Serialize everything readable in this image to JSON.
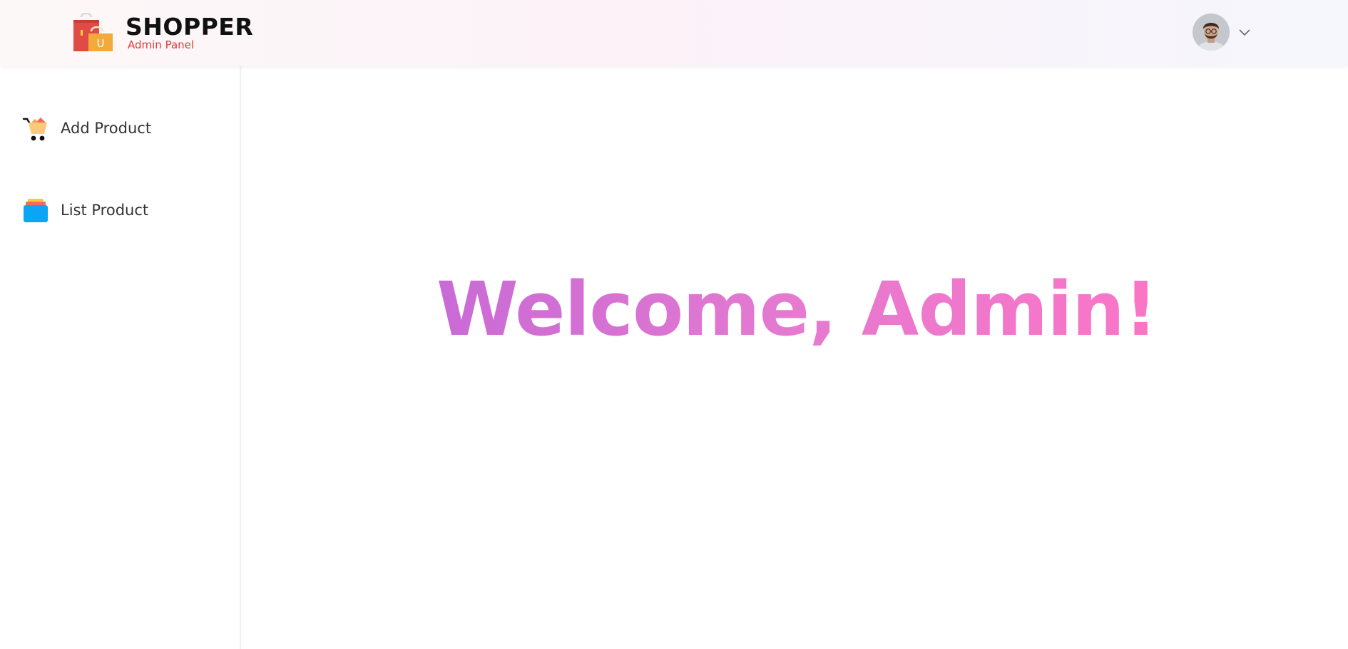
{
  "brand": {
    "name": "SHOPPER",
    "subtitle": "Admin Panel",
    "logo_icon": "shopping-bags-icon"
  },
  "header": {
    "avatar_icon": "user-avatar",
    "menu_icon": "chevron-down-icon"
  },
  "sidebar": {
    "items": [
      {
        "label": "Add Product",
        "icon": "shopping-cart-icon"
      },
      {
        "label": "List Product",
        "icon": "stacked-list-icon"
      }
    ]
  },
  "main": {
    "welcome_text": "Welcome, Admin!"
  },
  "colors": {
    "brand_red": "#e13a3a",
    "gradient_start": "#c96ad6",
    "gradient_end": "#fb75c6",
    "list_icon_blue": "#0aa5f5"
  }
}
